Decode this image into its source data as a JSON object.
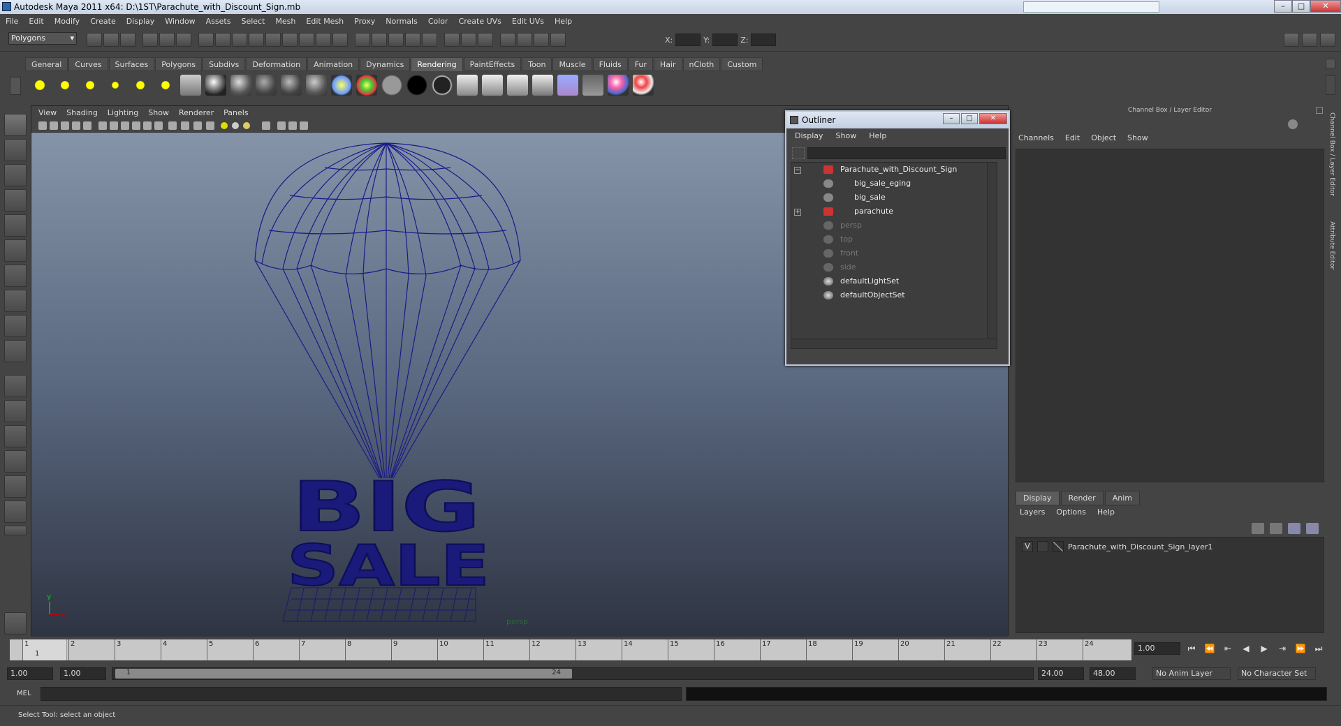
{
  "window": {
    "title": "Autodesk Maya 2011 x64: D:\\1ST\\Parachute_with_Discount_Sign.mb"
  },
  "menus": [
    "File",
    "Edit",
    "Modify",
    "Create",
    "Display",
    "Window",
    "Assets",
    "Select",
    "Mesh",
    "Edit Mesh",
    "Proxy",
    "Normals",
    "Color",
    "Create UVs",
    "Edit UVs",
    "Help"
  ],
  "status": {
    "mode": "Polygons",
    "x_label": "X:",
    "y_label": "Y:",
    "z_label": "Z:"
  },
  "shelf": {
    "tabs": [
      "General",
      "Curves",
      "Surfaces",
      "Polygons",
      "Subdivs",
      "Deformation",
      "Animation",
      "Dynamics",
      "Rendering",
      "PaintEffects",
      "Toon",
      "Muscle",
      "Fluids",
      "Fur",
      "Hair",
      "nCloth",
      "Custom"
    ],
    "active": "Rendering"
  },
  "viewport": {
    "menus": [
      "View",
      "Shading",
      "Lighting",
      "Show",
      "Renderer",
      "Panels"
    ],
    "camera_label": "persp",
    "axis_y": "y",
    "axis_x": "x",
    "sign_line1": "BIG",
    "sign_line2": "SALE"
  },
  "outliner": {
    "title": "Outliner",
    "menus": [
      "Display",
      "Show",
      "Help"
    ],
    "items": [
      {
        "label": "Parachute_with_Discount_Sign",
        "dim": false
      },
      {
        "label": "big_sale_eging",
        "dim": false
      },
      {
        "label": "big_sale",
        "dim": false
      },
      {
        "label": "parachute",
        "dim": false
      },
      {
        "label": "persp",
        "dim": true
      },
      {
        "label": "top",
        "dim": true
      },
      {
        "label": "front",
        "dim": true
      },
      {
        "label": "side",
        "dim": true
      },
      {
        "label": "defaultLightSet",
        "dim": false
      },
      {
        "label": "defaultObjectSet",
        "dim": false
      }
    ]
  },
  "channelbox": {
    "title": "Channel Box / Layer Editor",
    "menus": [
      "Channels",
      "Edit",
      "Object",
      "Show"
    ],
    "layer_tabs": [
      "Display",
      "Render",
      "Anim"
    ],
    "layer_menus": [
      "Layers",
      "Options",
      "Help"
    ],
    "layer_visibility": "V",
    "layer_name": "Parachute_with_Discount_Sign_layer1"
  },
  "sidetabs": {
    "channel": "Channel Box / Layer Editor",
    "attribute": "Attribute Editor"
  },
  "timeline": {
    "current_frame": "1",
    "frames": [
      "1",
      "2",
      "3",
      "4",
      "5",
      "6",
      "7",
      "8",
      "9",
      "10",
      "11",
      "12",
      "13",
      "14",
      "15",
      "16",
      "17",
      "18",
      "19",
      "20",
      "21",
      "22",
      "23",
      "24"
    ],
    "current_field": "1.00",
    "playback": [
      "⏮",
      "⏪",
      "⇤",
      "◀",
      "▶",
      "⇥",
      "⏩",
      "⏭"
    ]
  },
  "range": {
    "start": "1.00",
    "inner_start": "1.00",
    "handle_start": "1",
    "handle_end": "24",
    "inner_end": "24.00",
    "end": "48.00",
    "anim_layer": "No Anim Layer",
    "char_set": "No Character Set"
  },
  "cmd": {
    "label": "MEL"
  },
  "help": {
    "text": "Select Tool: select an object"
  }
}
